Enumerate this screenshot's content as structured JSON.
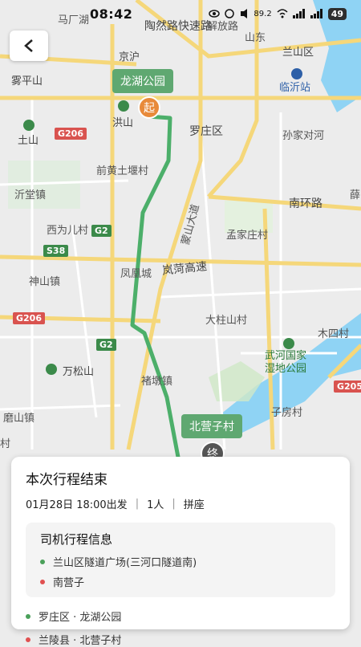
{
  "status_bar": {
    "time": "08:42",
    "network_speed": "89.2",
    "battery": "49"
  },
  "map": {
    "labels": {
      "malianghu": "马厂湖",
      "taoran_expressway": "陶然路快速路",
      "jiefang": "解放路",
      "shanxi": "山东",
      "wupingshan": "雾平山",
      "lanshan": "兰山区",
      "linyi_station": "临沂站",
      "hongshan": "洪山",
      "luozhuang": "罗庄区",
      "sunjiaduihe": "孙家对河",
      "tushan": "土山",
      "qianhuangtuduicun": "前黄土堰村",
      "yitangzhen": "沂堂镇",
      "nanhuanlu": "南环路",
      "xue": "薛",
      "mengshandadao": "蒙山大道",
      "xiweierzhuang": "西为儿村",
      "mengjiazhuang": "孟家庄村",
      "shenshanzhen": "神山镇",
      "fenghuangcheng": "凤凰城",
      "lanhe_expressway": "岚菏高速",
      "dazhushancun": "大柱山村",
      "musicun": "木四村",
      "wansongshan": "万松山",
      "wuhe_wetland": "武河国家湿地公园",
      "zhulaozhen": "褚墩镇",
      "zifangcun": "子房村",
      "modunzhen": "磨山镇",
      "cun_left": "村",
      "jinghu": "京沪"
    },
    "road_badges": {
      "g206_top": "G206",
      "g2_mid": "G2",
      "s38": "S38",
      "g206_bottom": "G206",
      "g2_bottom": "G2",
      "g205": "G205"
    },
    "start_tag": "龙湖公园",
    "start_marker": "起",
    "end_tag": "北营子村",
    "end_marker": "终"
  },
  "card": {
    "title": "本次行程结束",
    "date": "01月28日 18:00出发",
    "separator": "|",
    "people": "1人",
    "ride_type": "拼座",
    "driver_title": "司机行程信息",
    "driver_stops": [
      "兰山区隧道广场(三河口隧道南)",
      "南营子"
    ],
    "passenger_stops": [
      "罗庄区 · 龙湖公园",
      "兰陵县 · 北营子村"
    ]
  },
  "colors": {
    "route": "#4caf6a",
    "map_bg": "#ececec",
    "road_major": "#f5d77a",
    "river": "#8fd3f4"
  }
}
